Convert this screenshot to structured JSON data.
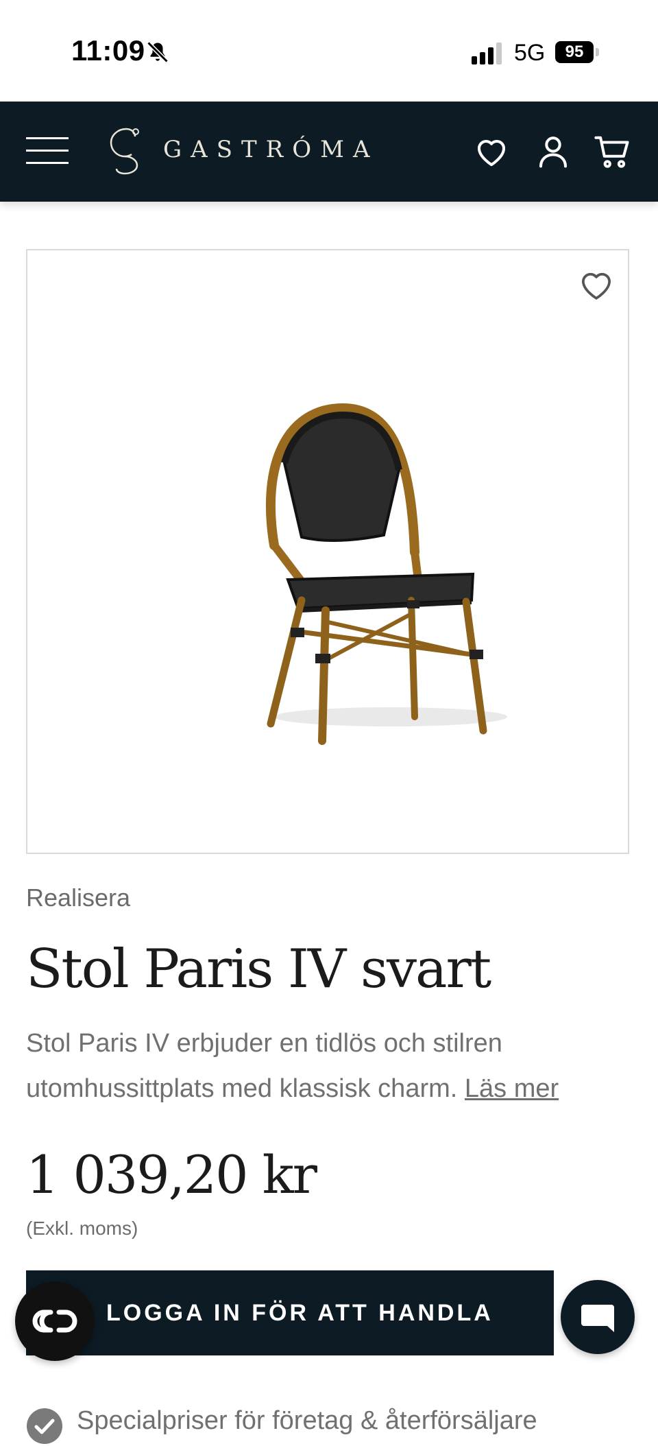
{
  "status_bar": {
    "time": "11:09",
    "network": "5G",
    "battery": "95"
  },
  "header": {
    "brand": "GASTRÓMA"
  },
  "product": {
    "category": "Realisera",
    "title": "Stol Paris IV svart",
    "description": "Stol Paris IV erbjuder en tidlös och stilren utomhussittplats med klassisk charm.",
    "read_more": "Läs mer",
    "price": "1 039,20 kr",
    "vat_note": "(Exkl. moms)",
    "cta_label": "LOGGA IN FÖR ATT HANDLA"
  },
  "features": [
    {
      "text": "Specialpriser för företag & återförsäljare"
    }
  ],
  "colors": {
    "brand_dark": "#0c1b24",
    "logo_gold": "#e9e4d8",
    "muted_text": "#707070"
  },
  "icons": [
    "menu-icon",
    "logo-mark",
    "heart-icon",
    "user-icon",
    "cart-icon",
    "favorite-icon",
    "loop-icon",
    "chat-icon",
    "check-icon",
    "bell-slash-icon"
  ]
}
